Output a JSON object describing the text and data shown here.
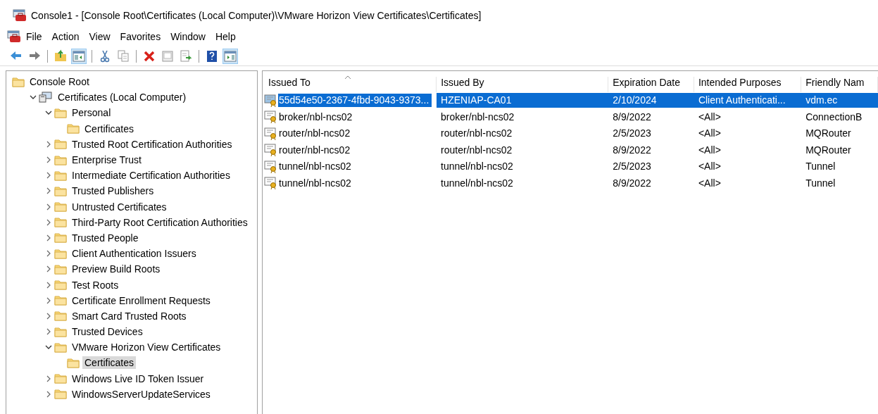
{
  "window": {
    "title": "Console1 - [Console Root\\Certificates (Local Computer)\\VMware Horizon View Certificates\\Certificates]"
  },
  "menu": [
    "File",
    "Action",
    "View",
    "Favorites",
    "Window",
    "Help"
  ],
  "toolbar": [
    {
      "kind": "back",
      "pressed": false
    },
    {
      "kind": "forward",
      "pressed": false
    },
    {
      "kind": "separator"
    },
    {
      "kind": "up",
      "pressed": false
    },
    {
      "kind": "tree",
      "pressed": true
    },
    {
      "kind": "separator"
    },
    {
      "kind": "cut",
      "pressed": false
    },
    {
      "kind": "copy",
      "pressed": false
    },
    {
      "kind": "separator"
    },
    {
      "kind": "delete",
      "pressed": false
    },
    {
      "kind": "properties",
      "pressed": false
    },
    {
      "kind": "export",
      "pressed": false
    },
    {
      "kind": "separator"
    },
    {
      "kind": "help",
      "pressed": false
    },
    {
      "kind": "pane",
      "pressed": true
    }
  ],
  "tree": [
    {
      "label": "Console Root",
      "selected": false,
      "children": [
        {
          "label": "Certificates (Local Computer)",
          "selected": false,
          "expanded": true,
          "kind": "computer",
          "children": [
            {
              "label": "Personal",
              "selected": false,
              "expanded": true,
              "children": [
                {
                  "label": "Certificates",
                  "selected": false
                }
              ]
            },
            {
              "label": "Trusted Root Certification Authorities",
              "selected": false,
              "expanded": false
            },
            {
              "label": "Enterprise Trust",
              "selected": false,
              "expanded": false
            },
            {
              "label": "Intermediate Certification Authorities",
              "selected": false,
              "expanded": false
            },
            {
              "label": "Trusted Publishers",
              "selected": false,
              "expanded": false
            },
            {
              "label": "Untrusted Certificates",
              "selected": false,
              "expanded": false
            },
            {
              "label": "Third-Party Root Certification Authorities",
              "selected": false,
              "expanded": false
            },
            {
              "label": "Trusted People",
              "selected": false,
              "expanded": false
            },
            {
              "label": "Client Authentication Issuers",
              "selected": false,
              "expanded": false
            },
            {
              "label": "Preview Build Roots",
              "selected": false,
              "expanded": false
            },
            {
              "label": "Test Roots",
              "selected": false,
              "expanded": false
            },
            {
              "label": "Certificate Enrollment Requests",
              "selected": false,
              "expanded": false
            },
            {
              "label": "Smart Card Trusted Roots",
              "selected": false,
              "expanded": false
            },
            {
              "label": "Trusted Devices",
              "selected": false,
              "expanded": false
            },
            {
              "label": "VMware Horizon View Certificates",
              "selected": false,
              "expanded": true,
              "children": [
                {
                  "label": "Certificates",
                  "selected": true
                }
              ]
            },
            {
              "label": "Windows Live ID Token Issuer",
              "selected": false,
              "expanded": false
            },
            {
              "label": "WindowsServerUpdateServices",
              "selected": false,
              "expanded": false
            }
          ]
        }
      ]
    }
  ],
  "table": {
    "columns": [
      {
        "label": "Issued To",
        "sorted": true
      },
      {
        "label": "Issued By",
        "sorted": false
      },
      {
        "label": "Expiration Date",
        "sorted": false
      },
      {
        "label": "Intended Purposes",
        "sorted": false
      },
      {
        "label": "Friendly Nam",
        "sorted": false
      }
    ],
    "rows": [
      {
        "selected": true,
        "cells": [
          "55d54e50-2367-4fbd-9043-9373...",
          "HZENIAP-CA01",
          "2/10/2024",
          "Client Authenticati...",
          "vdm.ec"
        ]
      },
      {
        "selected": false,
        "cells": [
          "broker/nbl-ncs02",
          "broker/nbl-ncs02",
          "8/9/2022",
          "<All>",
          "ConnectionB"
        ]
      },
      {
        "selected": false,
        "cells": [
          "router/nbl-ncs02",
          "router/nbl-ncs02",
          "2/5/2023",
          "<All>",
          "MQRouter"
        ]
      },
      {
        "selected": false,
        "cells": [
          "router/nbl-ncs02",
          "router/nbl-ncs02",
          "8/9/2022",
          "<All>",
          "MQRouter"
        ]
      },
      {
        "selected": false,
        "cells": [
          "tunnel/nbl-ncs02",
          "tunnel/nbl-ncs02",
          "2/5/2023",
          "<All>",
          "Tunnel"
        ]
      },
      {
        "selected": false,
        "cells": [
          "tunnel/nbl-ncs02",
          "tunnel/nbl-ncs02",
          "8/9/2022",
          "<All>",
          "Tunnel"
        ]
      }
    ]
  }
}
